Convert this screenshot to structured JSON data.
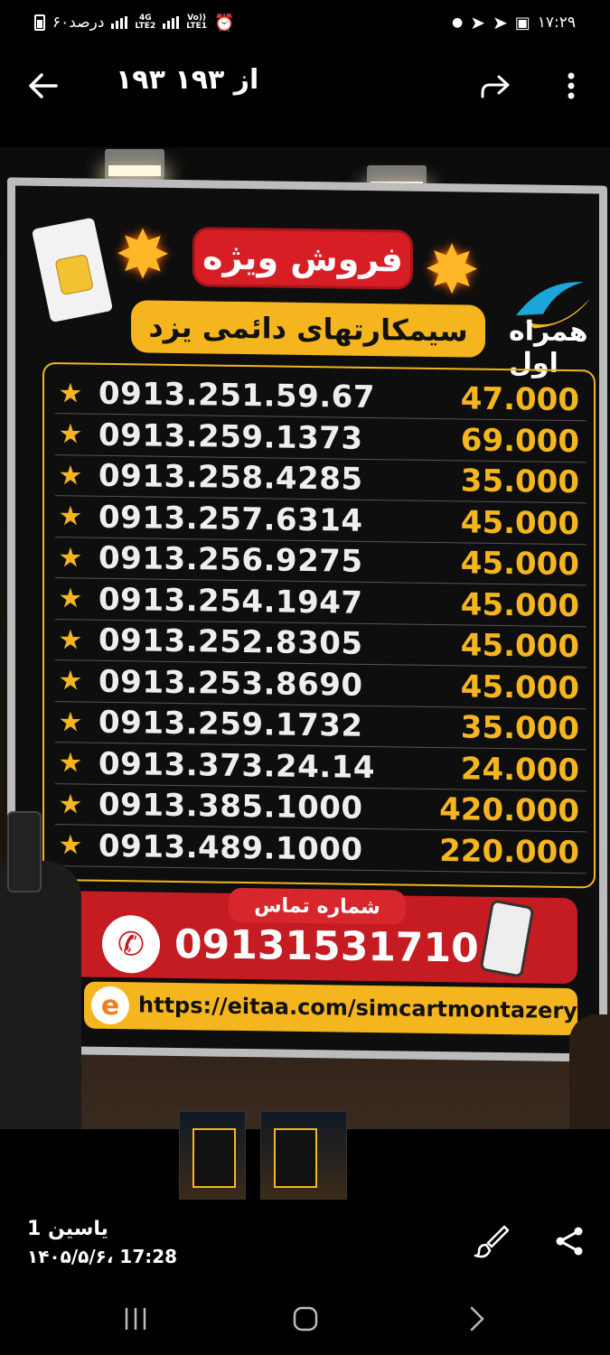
{
  "status_bar": {
    "battery": "۶۰درصد",
    "network_1": "4G",
    "network_1_sub": "LTE2",
    "network_2": "Vo))",
    "network_2_sub": "LTE1",
    "time": "۱۷:۲۹"
  },
  "top_bar": {
    "counter": "۱۹۳ از ۱۹۳",
    "back_icon": "arrow-left-icon",
    "forward_icon": "forward-arrow-icon",
    "menu_icon": "more-vert-icon"
  },
  "board": {
    "title": "فروش ویژه",
    "subtitle": "سیمکارتهای دائمی یزد",
    "brand": "همراه اول",
    "rows": [
      {
        "number": "0913.251.59.67",
        "price": "47.000"
      },
      {
        "number": "0913.259.1373",
        "price": "69.000"
      },
      {
        "number": "0913.258.4285",
        "price": "35.000"
      },
      {
        "number": "0913.257.6314",
        "price": "45.000"
      },
      {
        "number": "0913.256.9275",
        "price": "45.000"
      },
      {
        "number": "0913.254.1947",
        "price": "45.000"
      },
      {
        "number": "0913.252.8305",
        "price": "45.000"
      },
      {
        "number": "0913.253.8690",
        "price": "45.000"
      },
      {
        "number": "0913.259.1732",
        "price": "35.000"
      },
      {
        "number": "0913.373.24.14",
        "price": "24.000"
      },
      {
        "number": "0913.385.1000",
        "price": "420.000"
      },
      {
        "number": "0913.489.1000",
        "price": "220.000"
      }
    ],
    "contact_label": "شماره تماس",
    "contact_number": "09131531710",
    "link": "https://eitaa.com/simcartmontazery",
    "link_icon_letter": "e"
  },
  "footer": {
    "sender": "یاسین 1",
    "datetime": "۱۴۰۵/۵/۶، 17:28",
    "edit_icon": "brush-icon",
    "share_icon": "share-icon"
  },
  "colors": {
    "accent_yellow": "#f4b51f",
    "accent_red": "#d81e25",
    "background": "#000000"
  }
}
